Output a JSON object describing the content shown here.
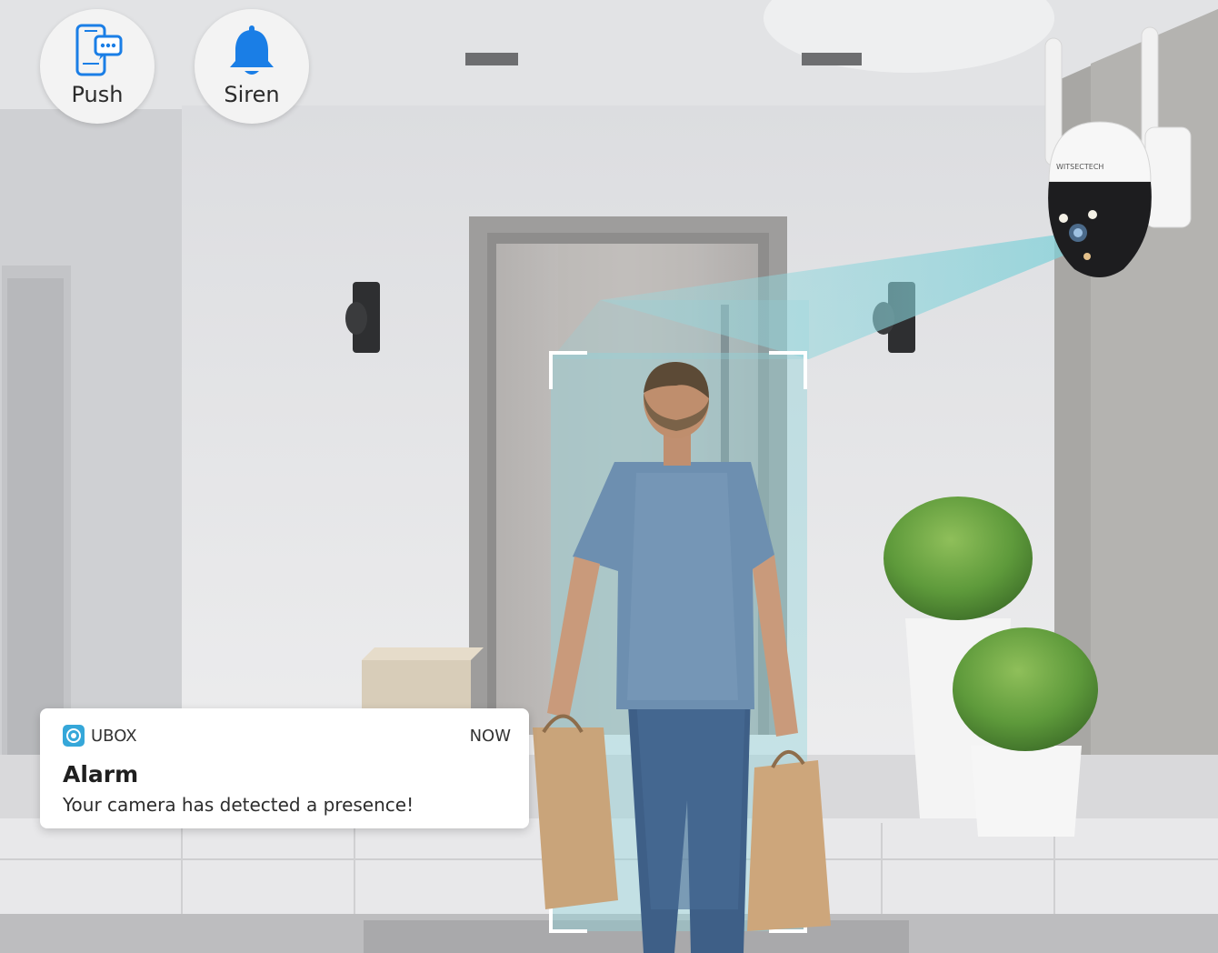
{
  "features": [
    {
      "label": "Push",
      "icon": "phone-message-icon"
    },
    {
      "label": "Siren",
      "icon": "bell-icon"
    }
  ],
  "camera": {
    "brand_text": "WITSECTECH"
  },
  "notification": {
    "app_name": "UBOX",
    "time": "NOW",
    "title": "Alarm",
    "message": "Your camera has detected a presence!"
  },
  "colors": {
    "accent_blue": "#1a7ee6",
    "detection_cyan": "#7ecfd6",
    "app_icon": "#35a7d9"
  }
}
